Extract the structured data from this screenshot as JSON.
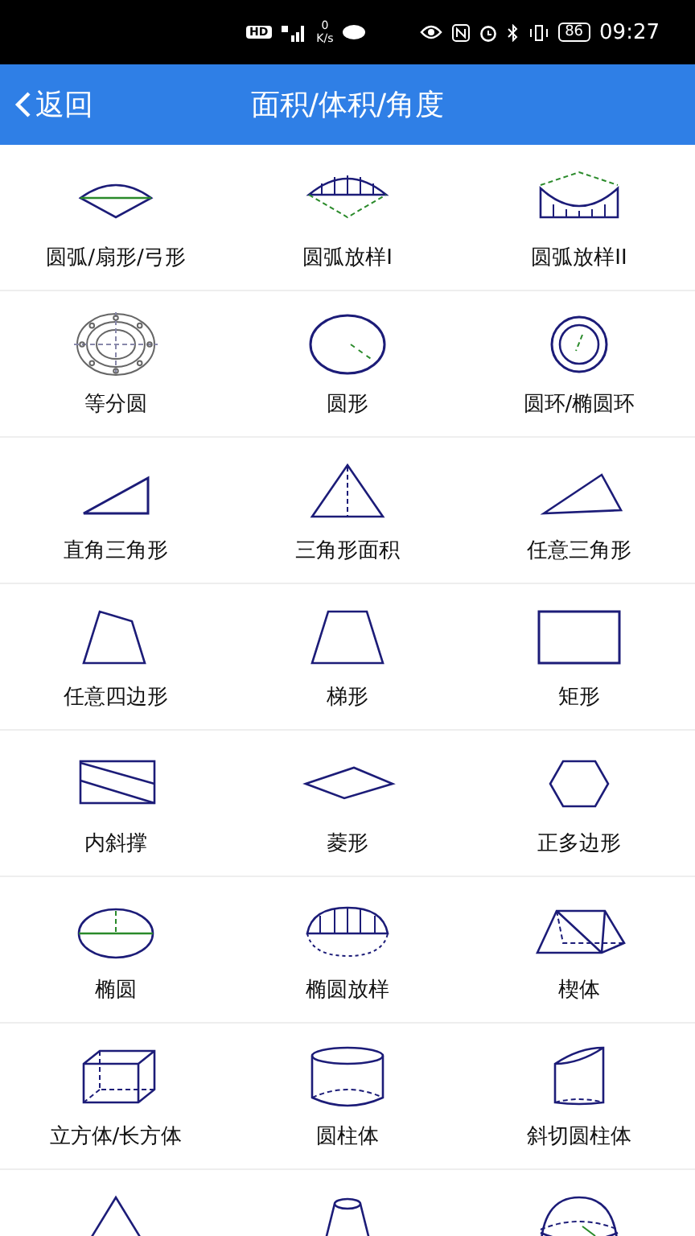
{
  "status_bar": {
    "hd": "HD",
    "speed_value": "0",
    "speed_unit": "K/s",
    "battery": "86",
    "time": "09:27"
  },
  "header": {
    "back": "返回",
    "title": "面积/体积/角度"
  },
  "items": [
    {
      "label": "圆弧/扇形/弓形"
    },
    {
      "label": "圆弧放样I"
    },
    {
      "label": "圆弧放样II"
    },
    {
      "label": "等分圆"
    },
    {
      "label": "圆形"
    },
    {
      "label": "圆环/椭圆环"
    },
    {
      "label": "直角三角形"
    },
    {
      "label": "三角形面积"
    },
    {
      "label": "任意三角形"
    },
    {
      "label": "任意四边形"
    },
    {
      "label": "梯形"
    },
    {
      "label": "矩形"
    },
    {
      "label": "内斜撑"
    },
    {
      "label": "菱形"
    },
    {
      "label": "正多边形"
    },
    {
      "label": "椭圆"
    },
    {
      "label": "椭圆放样"
    },
    {
      "label": "楔体"
    },
    {
      "label": "立方体/长方体"
    },
    {
      "label": "圆柱体"
    },
    {
      "label": "斜切圆柱体"
    }
  ]
}
